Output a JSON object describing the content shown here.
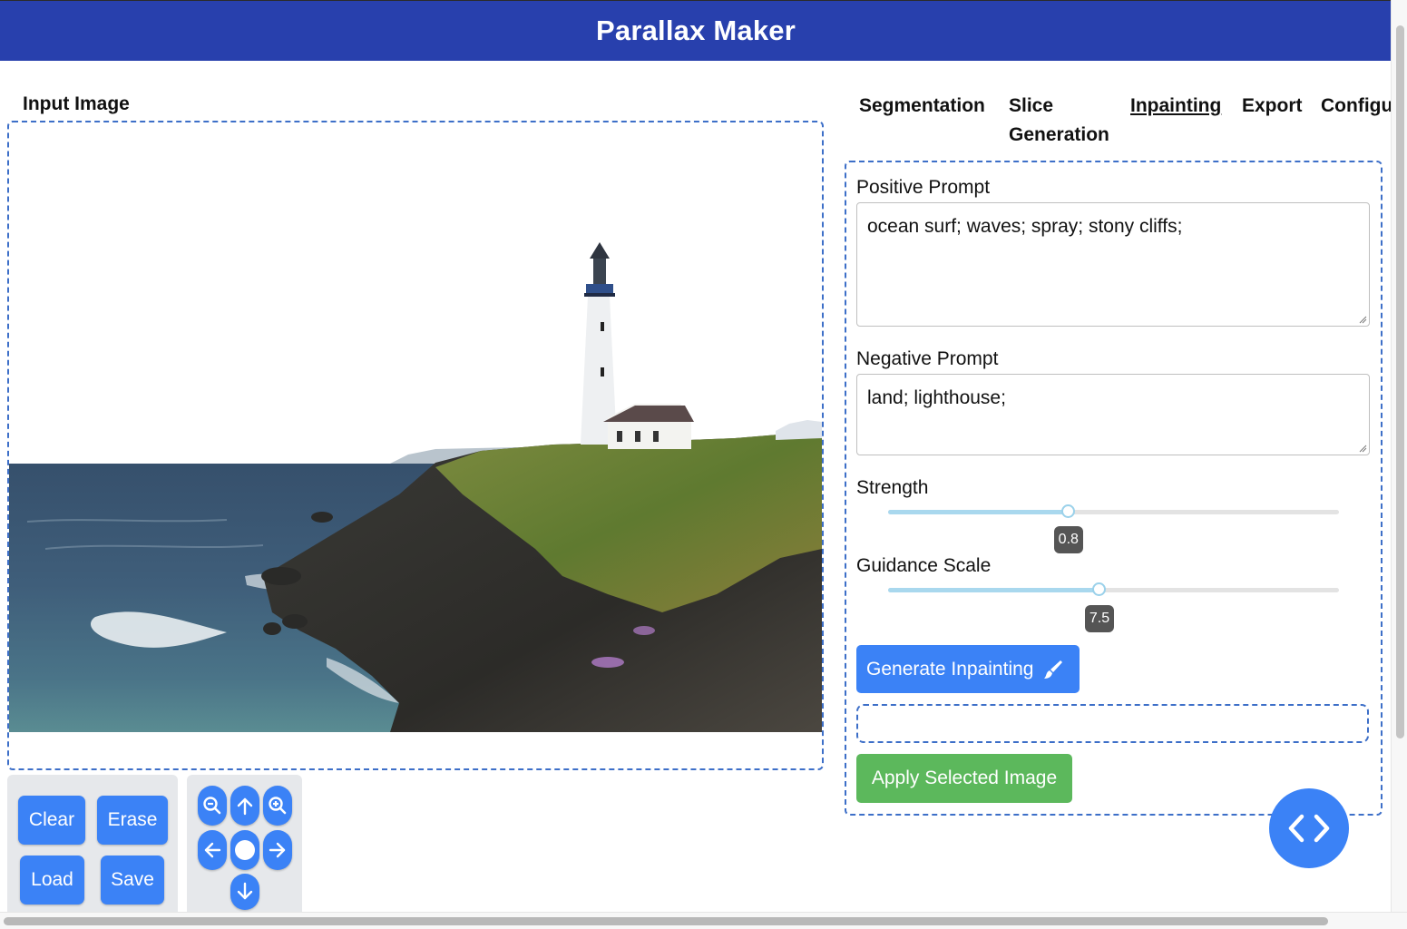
{
  "app": {
    "title": "Parallax Maker"
  },
  "input_section": {
    "title": "Input Image"
  },
  "image_buttons": {
    "clear": "Clear",
    "erase": "Erase",
    "load": "Load",
    "save": "Save"
  },
  "navigation_icons": [
    "zoom-out-icon",
    "arrow-up-icon",
    "zoom-in-icon",
    "arrow-left-icon",
    "center-dot-icon",
    "arrow-right-icon",
    "arrow-down-icon"
  ],
  "tabs": [
    {
      "label": "Segmentation",
      "active": false
    },
    {
      "label_line1": "Slice",
      "label_line2": "Generation",
      "active": false
    },
    {
      "label": "Inpainting",
      "active": true
    },
    {
      "label": "Export",
      "active": false
    },
    {
      "label": "Configu",
      "active": false
    }
  ],
  "inpainting": {
    "positive_label": "Positive Prompt",
    "positive_value": "ocean surf; waves; spray; stony cliffs;",
    "negative_label": "Negative Prompt",
    "negative_value": "land; lighthouse;",
    "strength_label": "Strength",
    "strength_value": "0.8",
    "strength_min": 0,
    "strength_max": 2,
    "guidance_label": "Guidance Scale",
    "guidance_value": "7.5",
    "guidance_min": 0,
    "guidance_max": 16,
    "generate_label": "Generate Inpainting",
    "apply_label": "Apply Selected Image"
  },
  "colors": {
    "header": "#2840ad",
    "primary": "#3b82f6",
    "success": "#5cb85c",
    "dashed_border": "#3d6fc8"
  },
  "icons": {
    "generate": "brush-icon",
    "fab": "code-icon"
  }
}
